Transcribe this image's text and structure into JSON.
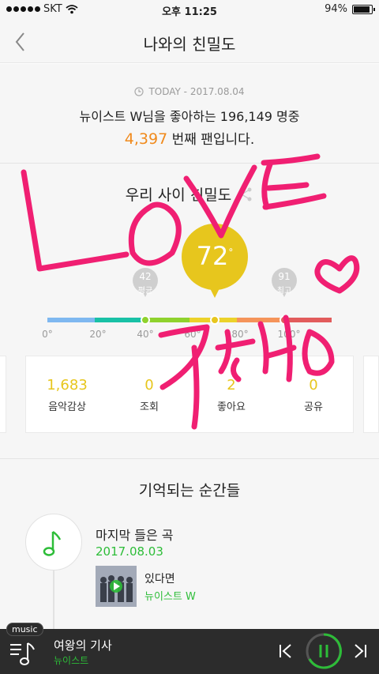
{
  "status_bar": {
    "carrier": "SKT",
    "time": "오후 11:25",
    "battery": "94%"
  },
  "header": {
    "title": "나와의 친밀도"
  },
  "summary": {
    "today_label": "TODAY - 2017.08.04",
    "line1": "뉴이스트 W님을 좋아하는 196,149 명중",
    "rank": "4,397",
    "rank_suffix": " 번째 팬입니다."
  },
  "intimacy": {
    "title": "우리 사이 친밀도",
    "score": "72",
    "score_value": 72,
    "average": {
      "value": "42",
      "label": "평균"
    },
    "maximum": {
      "value": "91",
      "label": "최고"
    },
    "ticks": [
      "0°",
      "20°",
      "40°",
      "60°",
      "80°",
      "100°"
    ]
  },
  "stats": [
    {
      "value": "1,683",
      "label": "음악감상"
    },
    {
      "value": "0",
      "label": "조회"
    },
    {
      "value": "2",
      "label": "좋아요"
    },
    {
      "value": "0",
      "label": "공유"
    }
  ],
  "memories": {
    "title": "기억되는 순간들",
    "last_song_title": "마지막 들은 곡",
    "date": "2017.08.03",
    "song": "있다면",
    "artist": "뉴이스트 W"
  },
  "player": {
    "tag": "music",
    "title": "여왕의 기사",
    "artist": "뉴이스트"
  },
  "colors": {
    "accent_green": "#2dbd38",
    "score_yellow": "#e7c61d",
    "rank_orange": "#f08a1c",
    "scribble_pink": "#f01f72"
  }
}
